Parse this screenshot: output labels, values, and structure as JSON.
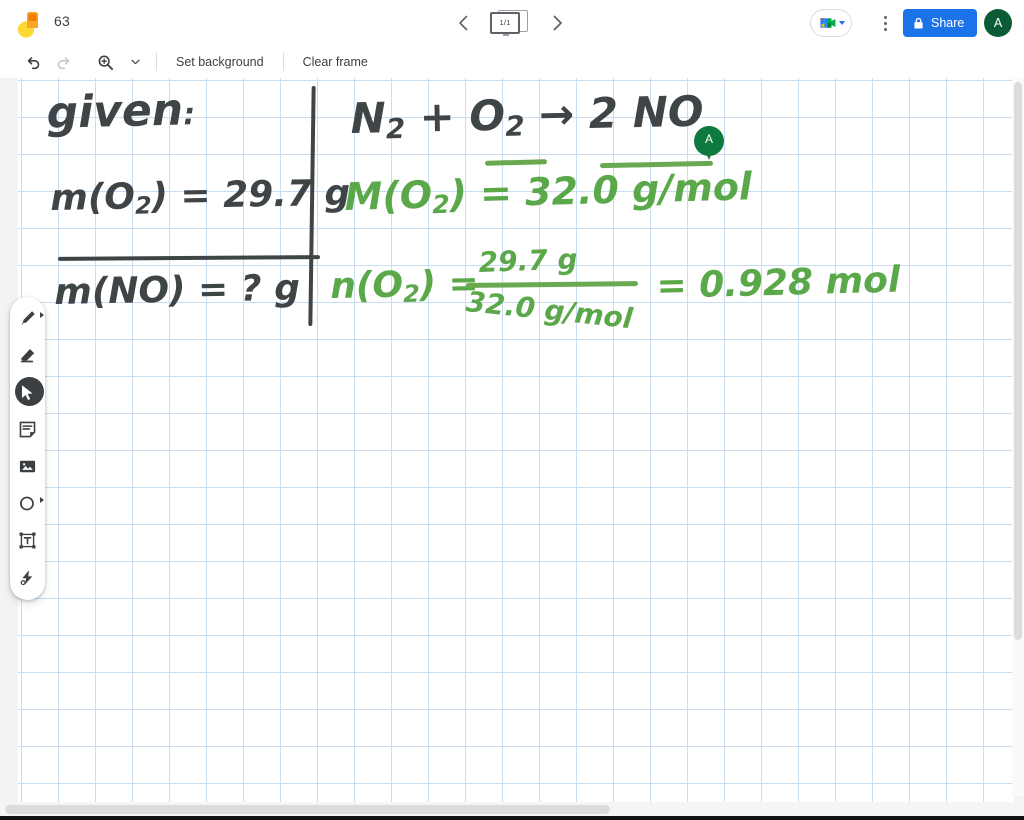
{
  "app": {
    "logo_icon": "jamboard-logo-icon",
    "doc_title": "63"
  },
  "frame_nav": {
    "prev_icon": "chevron-left-icon",
    "next_icon": "chevron-right-icon",
    "counter": "1/1",
    "frame_bar_icon": "frame-bar-icon"
  },
  "header_actions": {
    "meet_icon": "google-meet-icon",
    "meet_caret_icon": "chevron-down-icon",
    "more_icon": "three-dot-menu-icon",
    "share_label": "Share",
    "share_lock_icon": "lock-icon",
    "share_color": "#1a73e8",
    "avatar_letter": "A",
    "avatar_color": "#0b5c36"
  },
  "toolbar": {
    "undo_icon": "undo-icon",
    "redo_icon": "redo-icon",
    "zoom_icon": "zoom-in-icon",
    "zoom_caret_icon": "chevron-down-icon",
    "set_background_label": "Set background",
    "clear_frame_label": "Clear frame"
  },
  "tools": [
    {
      "name": "pen-tool",
      "icon": "pen-icon",
      "active": false,
      "has_caret": true
    },
    {
      "name": "eraser-tool",
      "icon": "eraser-icon",
      "active": false,
      "has_caret": false
    },
    {
      "name": "select-tool",
      "icon": "cursor-arrow-icon",
      "active": true,
      "has_caret": false
    },
    {
      "name": "sticky-note-tool",
      "icon": "sticky-note-icon",
      "active": false,
      "has_caret": false
    },
    {
      "name": "image-tool",
      "icon": "image-icon",
      "active": false,
      "has_caret": false
    },
    {
      "name": "shape-tool",
      "icon": "circle-shape-icon",
      "active": false,
      "has_caret": true
    },
    {
      "name": "text-box-tool",
      "icon": "text-box-icon",
      "active": false,
      "has_caret": false
    },
    {
      "name": "laser-pointer-tool",
      "icon": "laser-pointer-icon",
      "active": false,
      "has_caret": false
    }
  ],
  "canvas": {
    "background": "graph-grid",
    "grid_color": "#c9ddf2",
    "ink_dark": "#3f4447",
    "ink_green": "#5aa84a",
    "notes": {
      "given_label": "given:",
      "mass_o2": "m(O2) = 29.7 g",
      "mass_no": "m(NO) = ? g",
      "equation": "N2 + O2 → 2 NO",
      "molar_mass": "M(O2) = 32.0 g/mol",
      "moles_line": "n(O2) = 29.7 g / 32.0 g/mol = 0.928 mol",
      "frac_numerator": "29.7 g",
      "frac_denominator": "32.0 g/mol",
      "result": "0.928 mol"
    },
    "handwriting": {
      "given": "given",
      "given_colon": ":",
      "m_open": "m(O",
      "m_sub2": "2",
      "m_close": ") = 29.7 g",
      "mno_open": "m(NO) = ",
      "mno_q": "?",
      "mno_g": " g",
      "eq_n": "N",
      "eq_n_sub": "2",
      "eq_plus": " + ",
      "eq_o": "O",
      "eq_o_sub": "2",
      "eq_arrow": " → ",
      "eq_prod": "2 NO",
      "mm_m": "M(O",
      "mm_sub": "2",
      "mm_rest": ") = 32.0 g/mol",
      "n_label_a": "n(O",
      "n_label_sub": "2",
      "n_label_b": ") =",
      "frac_top": "29.7 g",
      "frac_bottom": "32.0 g/mol",
      "equals_result": "= 0.928 mol"
    }
  },
  "collaborator": {
    "pin_letter": "A",
    "pin_color": "#0f7a3d",
    "name": "collaborator-cursor"
  },
  "scrollbars": {
    "vertical": "vertical-scrollbar",
    "horizontal": "horizontal-scrollbar"
  }
}
